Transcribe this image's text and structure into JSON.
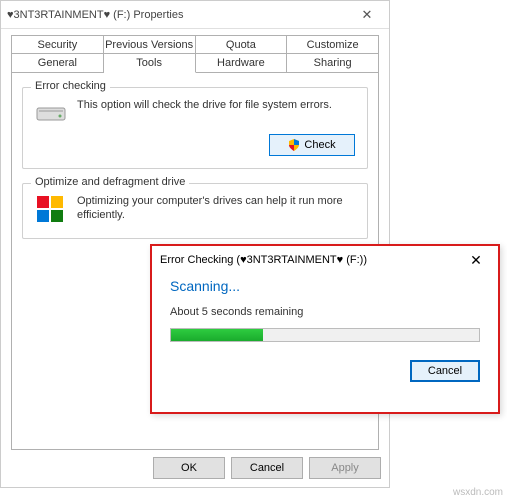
{
  "properties_window": {
    "title": "♥3NT3RTAINMENT♥ (F:) Properties",
    "tabs_row1": [
      "Security",
      "Previous Versions",
      "Quota",
      "Customize"
    ],
    "tabs_row2": [
      "General",
      "Tools",
      "Hardware",
      "Sharing"
    ],
    "active_tab": "Tools",
    "error_checking": {
      "group_label": "Error checking",
      "text": "This option will check the drive for file system errors.",
      "button": "Check"
    },
    "defrag": {
      "group_label": "Optimize and defragment drive",
      "text": "Optimizing your computer's drives can help it run more efficiently."
    },
    "buttons": {
      "ok": "OK",
      "cancel": "Cancel",
      "apply": "Apply"
    }
  },
  "error_dialog": {
    "title": "Error Checking (♥3NT3RTAINMENT♥ (F:))",
    "status": "Scanning...",
    "remaining": "About 5 seconds remaining",
    "progress_percent": 30,
    "cancel": "Cancel"
  },
  "watermark": "wsxdn.com"
}
